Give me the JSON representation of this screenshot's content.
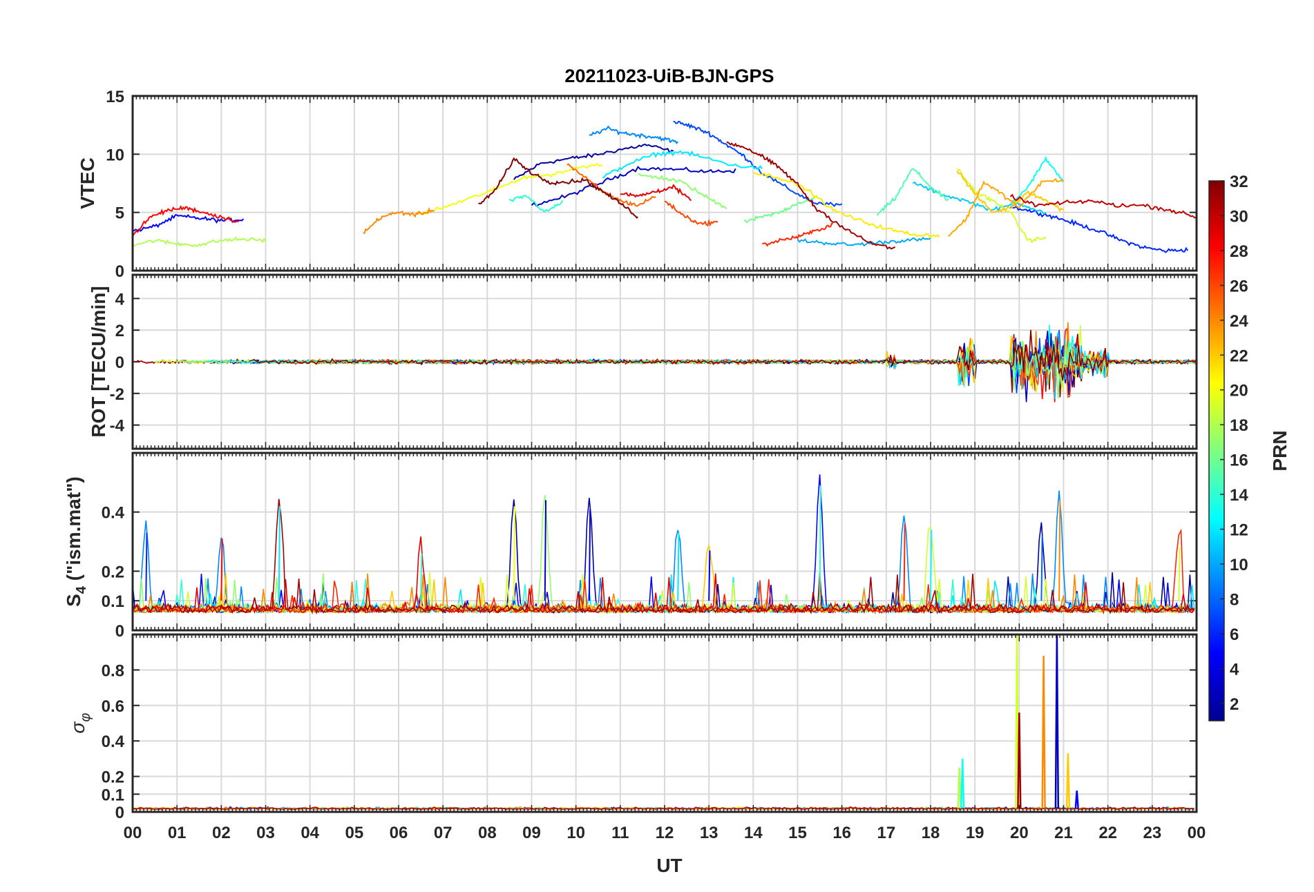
{
  "chart_data": {
    "type": "line",
    "title": "20211023-UiB-BJN-GPS",
    "xlabel": "UT",
    "x_tick_labels": [
      "00",
      "01",
      "02",
      "03",
      "04",
      "05",
      "06",
      "07",
      "08",
      "09",
      "10",
      "11",
      "12",
      "13",
      "14",
      "15",
      "16",
      "17",
      "18",
      "19",
      "20",
      "21",
      "22",
      "23",
      "00"
    ],
    "xlim": [
      0,
      24
    ],
    "grid": true,
    "colormap": "jet",
    "colorbar": {
      "label": "PRN",
      "range": [
        1,
        32
      ],
      "tick_labels": [
        "2",
        "4",
        "6",
        "8",
        "10",
        "12",
        "14",
        "16",
        "18",
        "20",
        "22",
        "24",
        "26",
        "28",
        "30",
        "32"
      ]
    },
    "panels": [
      {
        "ylabel": "VTEC",
        "ylim": [
          0,
          15
        ],
        "y_tick_labels": [
          "0",
          "5",
          "10",
          "15"
        ],
        "series": [
          {
            "prn": 2,
            "x": [
              8.6,
              9.2,
              9.8,
              10.4,
              11.0,
              11.6,
              12.2
            ],
            "y": [
              7.8,
              9.2,
              9.6,
              9.9,
              10.4,
              10.8,
              10.2
            ]
          },
          {
            "prn": 3,
            "x": [
              9.0,
              9.8,
              10.6,
              11.4,
              12.2,
              13.0,
              13.6
            ],
            "y": [
              5.6,
              6.4,
              7.6,
              8.8,
              8.7,
              8.5,
              8.6
            ]
          },
          {
            "prn": 5,
            "x": [
              0.0,
              0.5,
              1.0,
              1.5,
              2.0,
              2.5
            ],
            "y": [
              3.4,
              3.8,
              4.7,
              4.5,
              4.3,
              4.4
            ]
          },
          {
            "prn": 6,
            "x": [
              19.8,
              20.3,
              20.8,
              21.3,
              21.8,
              22.3,
              22.8,
              23.3,
              23.8
            ],
            "y": [
              5.5,
              5.1,
              4.6,
              4.0,
              3.4,
              2.6,
              2.0,
              1.7,
              1.8
            ]
          },
          {
            "prn": 7,
            "x": [
              12.2,
              12.6,
              13.0,
              13.4,
              13.8,
              14.2,
              14.8,
              15.4,
              16.0
            ],
            "y": [
              12.8,
              12.4,
              11.8,
              10.8,
              9.8,
              8.4,
              7.0,
              5.8,
              5.6
            ]
          },
          {
            "prn": 9,
            "x": [
              10.3,
              10.7,
              11.1,
              11.5,
              11.9,
              12.3
            ],
            "y": [
              11.6,
              12.2,
              11.8,
              11.6,
              11.4,
              11.0
            ]
          },
          {
            "prn": 10,
            "x": [
              15.0,
              15.6,
              16.2,
              16.8,
              17.4,
              18.0
            ],
            "y": [
              2.6,
              2.4,
              2.2,
              2.4,
              2.6,
              2.7
            ]
          },
          {
            "prn": 11,
            "x": [
              17.6,
              18.2,
              18.8,
              19.4,
              20.0,
              20.6
            ],
            "y": [
              7.6,
              6.6,
              6.0,
              5.2,
              5.8,
              4.9
            ]
          },
          {
            "prn": 12,
            "x": [
              10.6,
              11.2,
              11.8,
              12.4,
              13.0,
              13.6,
              14.2
            ],
            "y": [
              8.0,
              9.2,
              10.0,
              10.2,
              9.6,
              9.0,
              8.8
            ]
          },
          {
            "prn": 13,
            "x": [
              19.8,
              20.2,
              20.6,
              21.0
            ],
            "y": [
              5.6,
              7.2,
              9.6,
              7.6
            ]
          },
          {
            "prn": 14,
            "x": [
              8.5,
              8.9,
              9.3,
              9.7
            ],
            "y": [
              6.0,
              6.4,
              5.0,
              5.9
            ]
          },
          {
            "prn": 15,
            "x": [
              16.8,
              17.2,
              17.6,
              18.0,
              18.4
            ],
            "y": [
              4.8,
              6.2,
              8.8,
              7.2,
              6.0
            ]
          },
          {
            "prn": 16,
            "x": [
              13.8,
              14.2,
              14.6,
              15.0,
              15.4
            ],
            "y": [
              4.2,
              4.6,
              5.0,
              5.8,
              6.2
            ]
          },
          {
            "prn": 17,
            "x": [
              11.4,
              11.9,
              12.4,
              12.9,
              13.4
            ],
            "y": [
              8.2,
              8.0,
              7.6,
              6.4,
              5.4
            ]
          },
          {
            "prn": 18,
            "x": [
              0.0,
              0.5,
              1.0,
              1.5,
              2.0,
              2.5,
              3.0
            ],
            "y": [
              2.2,
              2.6,
              2.3,
              2.2,
              2.6,
              2.7,
              2.6
            ]
          },
          {
            "prn": 19,
            "x": [
              18.6,
              19.0,
              19.4,
              19.8,
              20.2,
              20.6
            ],
            "y": [
              8.8,
              6.8,
              6.0,
              5.0,
              2.6,
              2.8
            ]
          },
          {
            "prn": 20,
            "x": [
              6.4,
              7.0,
              7.6,
              8.2,
              8.8,
              9.4,
              10.0,
              10.6
            ],
            "y": [
              4.8,
              5.4,
              6.2,
              7.0,
              8.0,
              8.2,
              8.8,
              9.2
            ]
          },
          {
            "prn": 21,
            "x": [
              14.0,
              14.6,
              15.2,
              15.8,
              16.4,
              17.0,
              17.6,
              18.2
            ],
            "y": [
              8.4,
              8.0,
              7.0,
              5.2,
              4.3,
              3.6,
              3.1,
              3.0
            ]
          },
          {
            "prn": 22,
            "x": [
              18.6,
              19.0,
              19.4,
              19.8,
              20.2,
              20.6,
              21.0
            ],
            "y": [
              8.6,
              6.6,
              5.0,
              5.4,
              6.8,
              6.0,
              5.2
            ]
          },
          {
            "prn": 23,
            "x": [
              18.4,
              18.8,
              19.2,
              19.6,
              20.0,
              20.5,
              21.0
            ],
            "y": [
              3.0,
              4.4,
              7.6,
              6.6,
              5.4,
              7.6,
              7.8
            ]
          },
          {
            "prn": 24,
            "x": [
              5.2,
              5.6,
              6.0,
              6.4,
              6.8
            ],
            "y": [
              3.2,
              4.6,
              5.0,
              4.8,
              5.2
            ]
          },
          {
            "prn": 25,
            "x": [
              9.8,
              10.2,
              10.6,
              11.0,
              11.4,
              11.8
            ],
            "y": [
              9.2,
              8.0,
              6.8,
              6.0,
              5.6,
              6.4
            ]
          },
          {
            "prn": 26,
            "x": [
              12.0,
              12.4,
              12.8,
              13.2
            ],
            "y": [
              6.0,
              4.8,
              4.0,
              4.2
            ]
          },
          {
            "prn": 27,
            "x": [
              14.2,
              14.6,
              15.0,
              15.4,
              15.8
            ],
            "y": [
              2.2,
              2.6,
              2.9,
              3.4,
              4.0
            ]
          },
          {
            "prn": 28,
            "x": [
              0.0,
              0.4,
              0.8,
              1.2,
              1.6,
              2.0,
              2.4
            ],
            "y": [
              3.0,
              4.6,
              5.2,
              5.4,
              5.0,
              4.6,
              4.2
            ]
          },
          {
            "prn": 29,
            "x": [
              11.0,
              11.4,
              11.8,
              12.2,
              12.6
            ],
            "y": [
              6.6,
              6.4,
              6.8,
              7.2,
              6.0
            ]
          },
          {
            "prn": 30,
            "x": [
              19.8,
              20.4,
              21.0,
              21.6,
              22.2,
              22.8,
              23.4,
              24.0
            ],
            "y": [
              6.4,
              5.6,
              5.8,
              6.0,
              5.6,
              5.6,
              5.2,
              4.6
            ]
          },
          {
            "prn": 31,
            "x": [
              13.4,
              13.8,
              14.2,
              14.6,
              15.0,
              15.4,
              16.0,
              16.6,
              17.2
            ],
            "y": [
              11.0,
              10.6,
              9.8,
              8.8,
              7.4,
              5.4,
              3.8,
              2.4,
              1.9
            ]
          },
          {
            "prn": 32,
            "x": [
              7.8,
              8.2,
              8.6,
              9.0,
              9.4,
              9.8,
              10.2,
              10.6,
              11.0,
              11.4
            ],
            "y": [
              5.6,
              7.0,
              9.6,
              8.4,
              7.6,
              7.6,
              7.8,
              6.8,
              5.8,
              4.6
            ]
          }
        ]
      },
      {
        "ylabel": "ROT [TECU/min]",
        "ylim": [
          -5.5,
          5.5
        ],
        "y_tick_labels": [
          "-4",
          "-2",
          "0",
          "2",
          "4"
        ],
        "event_bursts": [
          {
            "x": [
              17.0,
              17.2
            ],
            "amplitude": 0.9
          },
          {
            "x": [
              18.6,
              19.0
            ],
            "amplitude": 2.6
          },
          {
            "x": [
              19.8,
              21.4
            ],
            "amplitude": 3.8
          },
          {
            "x": [
              21.4,
              22.0
            ],
            "amplitude": 1.6
          }
        ]
      },
      {
        "ylabel": "S4 (\"ism.mat\")",
        "ylim": [
          0,
          0.6
        ],
        "y_tick_labels": [
          "0",
          "0.1",
          "0.2",
          "0.4"
        ],
        "peaks": [
          {
            "x": 0.3,
            "y": 0.33
          },
          {
            "x": 2.0,
            "y": 0.31
          },
          {
            "x": 3.3,
            "y": 0.42
          },
          {
            "x": 6.5,
            "y": 0.26
          },
          {
            "x": 8.6,
            "y": 0.42
          },
          {
            "x": 9.3,
            "y": 0.44
          },
          {
            "x": 10.3,
            "y": 0.41
          },
          {
            "x": 12.3,
            "y": 0.33
          },
          {
            "x": 13.0,
            "y": 0.27
          },
          {
            "x": 15.5,
            "y": 0.49
          },
          {
            "x": 17.4,
            "y": 0.36
          },
          {
            "x": 18.0,
            "y": 0.34
          },
          {
            "x": 20.5,
            "y": 0.32
          },
          {
            "x": 20.9,
            "y": 0.44
          },
          {
            "x": 23.6,
            "y": 0.28
          }
        ]
      },
      {
        "ylabel": "σφ",
        "ylim": [
          0,
          1.0
        ],
        "y_tick_labels": [
          "0",
          "0.1",
          "0.2",
          "0.4",
          "0.6",
          "0.8"
        ],
        "spikes": [
          {
            "x": 18.65,
            "y": 0.25,
            "prn": 18
          },
          {
            "x": 18.72,
            "y": 0.3,
            "prn": 13
          },
          {
            "x": 19.95,
            "y": 1.0,
            "prn": 19
          },
          {
            "x": 20.0,
            "y": 0.56,
            "prn": 31
          },
          {
            "x": 20.55,
            "y": 0.88,
            "prn": 24
          },
          {
            "x": 20.85,
            "y": 1.0,
            "prn": 3
          },
          {
            "x": 21.1,
            "y": 0.33,
            "prn": 22
          },
          {
            "x": 21.3,
            "y": 0.12,
            "prn": 5
          }
        ]
      }
    ]
  }
}
